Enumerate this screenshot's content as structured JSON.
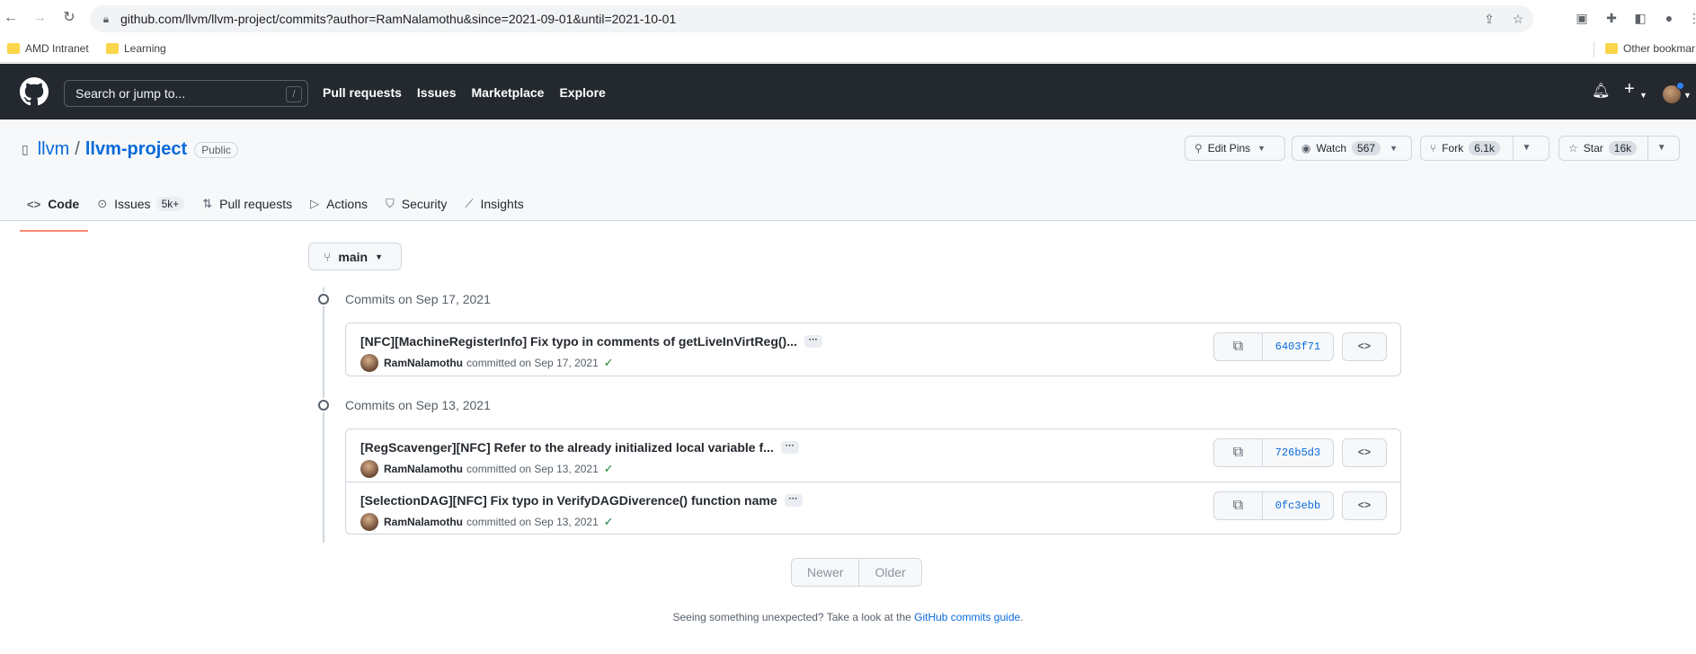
{
  "browser": {
    "url": "github.com/llvm/llvm-project/commits?author=RamNalamothu&since=2021-09-01&until=2021-10-01",
    "bookmarks": [
      "AMD Intranet",
      "Learning"
    ],
    "other_bookmarks": "Other bookmar"
  },
  "github": {
    "search_placeholder": "Search or jump to...",
    "search_shortcut": "/",
    "nav": [
      "Pull requests",
      "Issues",
      "Marketplace",
      "Explore"
    ]
  },
  "repo": {
    "owner": "llvm",
    "name": "llvm-project",
    "visibility": "Public",
    "edit_pins": "Edit Pins",
    "watch_label": "Watch",
    "watch_count": "567",
    "fork_label": "Fork",
    "fork_count": "6.1k",
    "star_label": "Star",
    "star_count": "16k"
  },
  "tabs": [
    {
      "label": "Code",
      "icon": "code-icon"
    },
    {
      "label": "Issues",
      "icon": "issue-icon",
      "count": "5k+"
    },
    {
      "label": "Pull requests",
      "icon": "pull-request-icon"
    },
    {
      "label": "Actions",
      "icon": "play-icon"
    },
    {
      "label": "Security",
      "icon": "shield-icon"
    },
    {
      "label": "Insights",
      "icon": "graph-icon"
    }
  ],
  "branch": "main",
  "groups": [
    {
      "heading": "Commits on Sep 17, 2021",
      "commits": [
        {
          "message": "[NFC][MachineRegisterInfo] Fix typo in comments of getLiveInVirtReg()...",
          "author": "RamNalamothu",
          "date": "committed on Sep 17, 2021",
          "sha": "6403f71"
        }
      ]
    },
    {
      "heading": "Commits on Sep 13, 2021",
      "commits": [
        {
          "message": "[RegScavenger][NFC] Refer to the already initialized local variable f...",
          "author": "RamNalamothu",
          "date": "committed on Sep 13, 2021",
          "sha": "726b5d3"
        },
        {
          "message": "[SelectionDAG][NFC] Fix typo in VerifyDAGDiverence() function name",
          "author": "RamNalamothu",
          "date": "committed on Sep 13, 2021",
          "sha": "0fc3ebb"
        }
      ]
    }
  ],
  "ellipsis": "···",
  "browse_glyph": "<>",
  "pagination": {
    "newer": "Newer",
    "older": "Older"
  },
  "footer": {
    "text": "Seeing something unexpected? Take a look at the ",
    "link": "GitHub commits guide",
    "end": "."
  },
  "colors": {
    "header_bg": "#24292f",
    "link": "#0969da",
    "active_tab": "#fd8c73",
    "check": "#1a7f37"
  }
}
